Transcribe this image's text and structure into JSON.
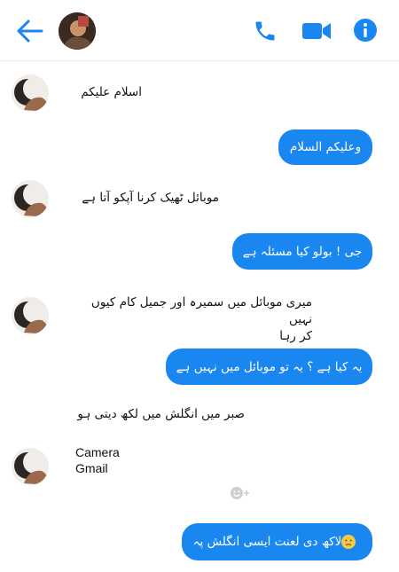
{
  "header": {
    "back_icon": "arrow-left-icon",
    "call_icon": "phone-icon",
    "video_icon": "video-camera-icon",
    "info_icon": "info-icon",
    "accent": "#1a86f0"
  },
  "messages": [
    {
      "side": "in",
      "text": "اسلام علیکم"
    },
    {
      "side": "out",
      "text": "وعلیکم السلام"
    },
    {
      "side": "in",
      "text": "موبائل ٹھیک کرنا آپکو آتا ہے"
    },
    {
      "side": "out",
      "text": "جی ! بولو  کیا مسئلہ ہے"
    },
    {
      "side": "in",
      "line1": "میری موبائل میں سمیرہ اور جمیل کام کیوں نہیں",
      "line2": "کر رہا"
    },
    {
      "side": "out",
      "text": "یہ کیا ہے ؟ یہ تو موبائل میں نہیں ہے"
    },
    {
      "side": "in",
      "text": "صبر میں انگلش میں لکھ دیتی ہو"
    },
    {
      "side": "in",
      "line1": "Camera",
      "line2": "Gmail"
    },
    {
      "side": "out",
      "text": "لاکھ دی لعنت ایسی انگلش پہ",
      "emoji": "sad-face-emoji"
    }
  ],
  "reaction_icon": "add-reaction-icon"
}
